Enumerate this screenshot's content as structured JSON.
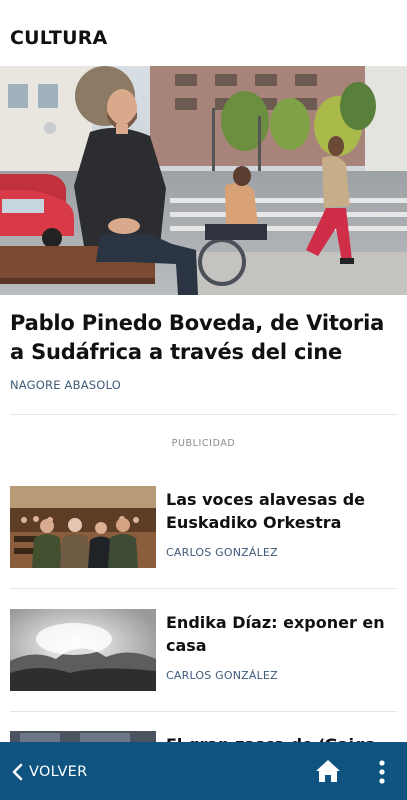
{
  "header": {
    "section": "CULTURA"
  },
  "lead": {
    "title": "Pablo Pinedo Boveda, de Vitoria a Sudáfrica a través del cine",
    "author": "NAGORE ABASOLO"
  },
  "ad": {
    "label": "PUBLICIDAD"
  },
  "articles": [
    {
      "title": "Las voces alavesas de Euskadiko Orkestra",
      "author": "CARLOS GONZÁLEZ"
    },
    {
      "title": "Endika Díaz: exponer en casa",
      "author": "CARLOS GONZÁLEZ"
    },
    {
      "title": "El gran zasca de ‘Gaiga"
    }
  ],
  "nav": {
    "back_label": "VOLVER",
    "icons": {
      "back": "chevron-left-icon",
      "home": "home-icon",
      "more": "more-vertical-icon"
    }
  },
  "colors": {
    "bar": "#0f5480",
    "author": "#3e5a78",
    "ad_label": "#8a8a8a"
  }
}
